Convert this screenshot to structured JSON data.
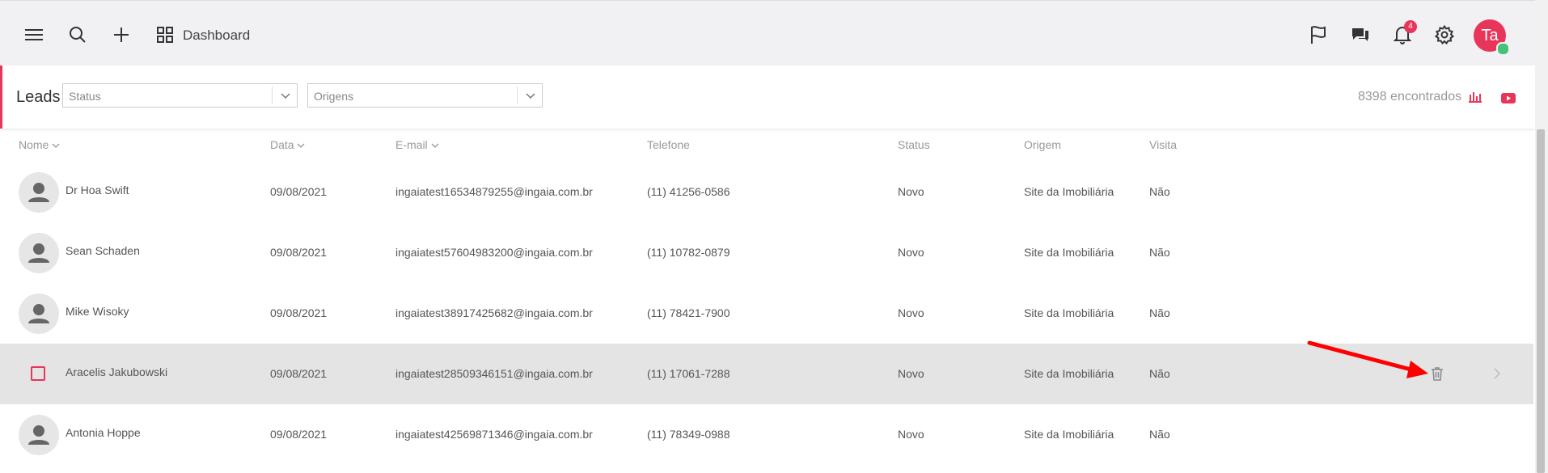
{
  "topbar": {
    "menu_icon": "hamburger-icon",
    "search_icon": "search-icon",
    "add_icon": "plus-icon",
    "dashboard_icon": "grid-icon",
    "dashboard_label": "Dashboard",
    "notifications_count": "4",
    "avatar_initials": "Ta"
  },
  "filters": {
    "title": "Leads",
    "status_placeholder": "Status",
    "origins_placeholder": "Origens",
    "found_text": "8398 encontrados"
  },
  "table": {
    "headers": [
      "Nome",
      "Data",
      "E-mail",
      "Telefone",
      "Status",
      "Origem",
      "Visita"
    ],
    "rows": [
      {
        "name": "Dr Hoa Swift",
        "date": "09/08/2021",
        "email": "ingaiatest16534879255@ingaia.com.br",
        "phone": "(11) 41256-0586",
        "status": "Novo",
        "origin": "Site da Imobiliária",
        "visit": "Não"
      },
      {
        "name": "Sean Schaden",
        "date": "09/08/2021",
        "email": "ingaiatest57604983200@ingaia.com.br",
        "phone": "(11) 10782-0879",
        "status": "Novo",
        "origin": "Site da Imobiliária",
        "visit": "Não"
      },
      {
        "name": "Mike Wisoky",
        "date": "09/08/2021",
        "email": "ingaiatest38917425682@ingaia.com.br",
        "phone": "(11) 78421-7900",
        "status": "Novo",
        "origin": "Site da Imobiliária",
        "visit": "Não"
      },
      {
        "name": "Aracelis Jakubowski",
        "date": "09/08/2021",
        "email": "ingaiatest28509346151@ingaia.com.br",
        "phone": "(11) 17061-7288",
        "status": "Novo",
        "origin": "Site da Imobiliária",
        "visit": "Não"
      },
      {
        "name": "Antonia Hoppe",
        "date": "09/08/2021",
        "email": "ingaiatest42569871346@ingaia.com.br",
        "phone": "(11) 78349-0988",
        "status": "Novo",
        "origin": "Site da Imobiliária",
        "visit": "Não"
      }
    ]
  },
  "colors": {
    "accent": "#e8355a",
    "online": "#43c27a",
    "annotation": "#ff0000"
  }
}
